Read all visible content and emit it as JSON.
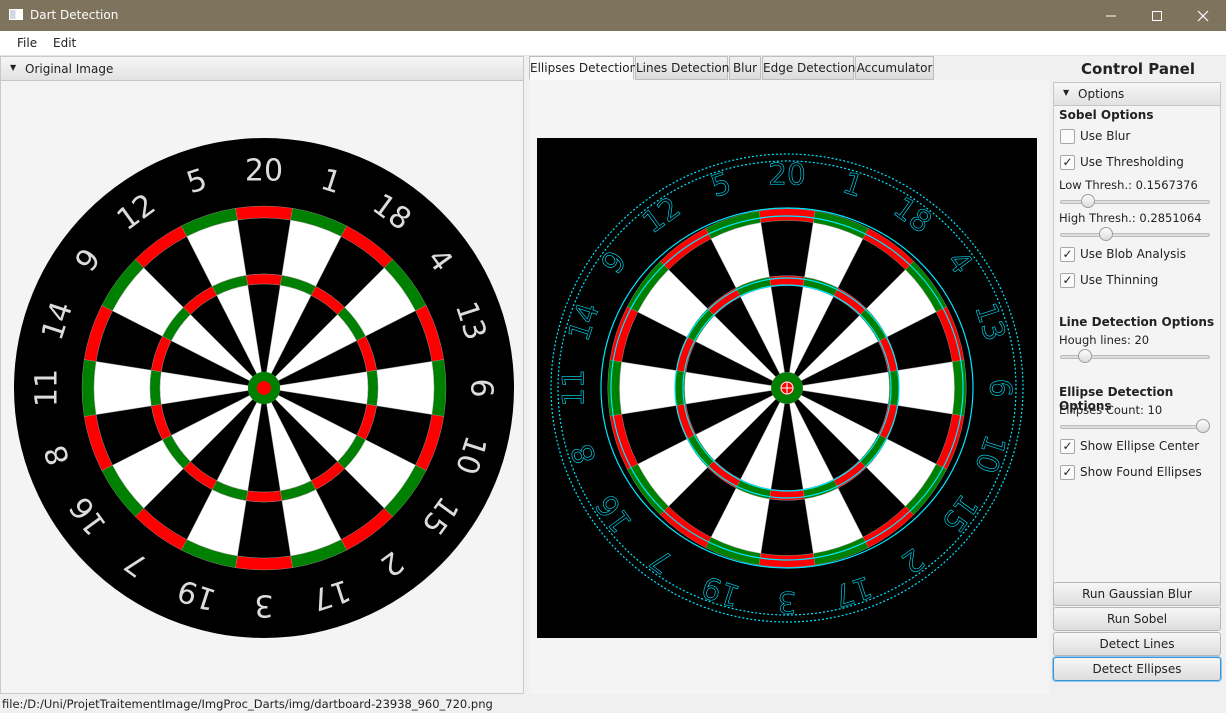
{
  "window": {
    "title": "Dart Detection",
    "minimize_icon": "minimize-icon",
    "maximize_icon": "maximize-icon",
    "close_icon": "close-icon"
  },
  "menu": {
    "items": [
      "File",
      "Edit"
    ]
  },
  "left_pane": {
    "header": "Original Image"
  },
  "board_numbers": [
    "20",
    "1",
    "18",
    "4",
    "13",
    "6",
    "10",
    "15",
    "2",
    "17",
    "3",
    "19",
    "7",
    "16",
    "8",
    "11",
    "14",
    "9",
    "12",
    "5"
  ],
  "tabs": [
    "Ellipses Detection",
    "Lines Detection",
    "Blur",
    "Edge Detection",
    "Accumulator"
  ],
  "active_tab": 0,
  "control_panel": {
    "title": "Control Panel",
    "options_header": "Options",
    "sobel": {
      "title": "Sobel Options",
      "use_blur": {
        "label": "Use Blur",
        "checked": false
      },
      "use_thresholding": {
        "label": "Use Thresholding",
        "checked": true
      },
      "low_thresh": {
        "label": "Low Thresh.: 0.1567376",
        "value": 0.1567376
      },
      "high_thresh": {
        "label": "High Thresh.: 0.2851064",
        "value": 0.2851064
      },
      "use_blob": {
        "label": "Use Blob Analysis",
        "checked": true
      },
      "use_thinning": {
        "label": "Use Thinning",
        "checked": true
      }
    },
    "line": {
      "title": "Line Detection Options",
      "hough": {
        "label": "Hough lines: 20",
        "value": 20
      }
    },
    "ellipse": {
      "title": "Ellipse Detection Options",
      "count": {
        "label": "Ellipses Count: 10",
        "value": 10
      },
      "show_center": {
        "label": "Show Ellipse Center",
        "checked": true
      },
      "show_found": {
        "label": "Show Found Ellipses",
        "checked": true
      }
    },
    "buttons": {
      "gaussian": "Run Gaussian Blur",
      "sobel": "Run Sobel",
      "lines": "Detect Lines",
      "ellipses": "Detect Ellipses"
    }
  },
  "status": "file:/D:/Uni/ProjetTraitementImage/ImgProc_Darts/img/dartboard-23938_960_720.png",
  "colors": {
    "title_bar": "#7e735c",
    "red": "#ff0000",
    "green": "#008000",
    "cyan": "#00e5ff",
    "board_black": "#000000",
    "board_white": "#ffffff"
  }
}
